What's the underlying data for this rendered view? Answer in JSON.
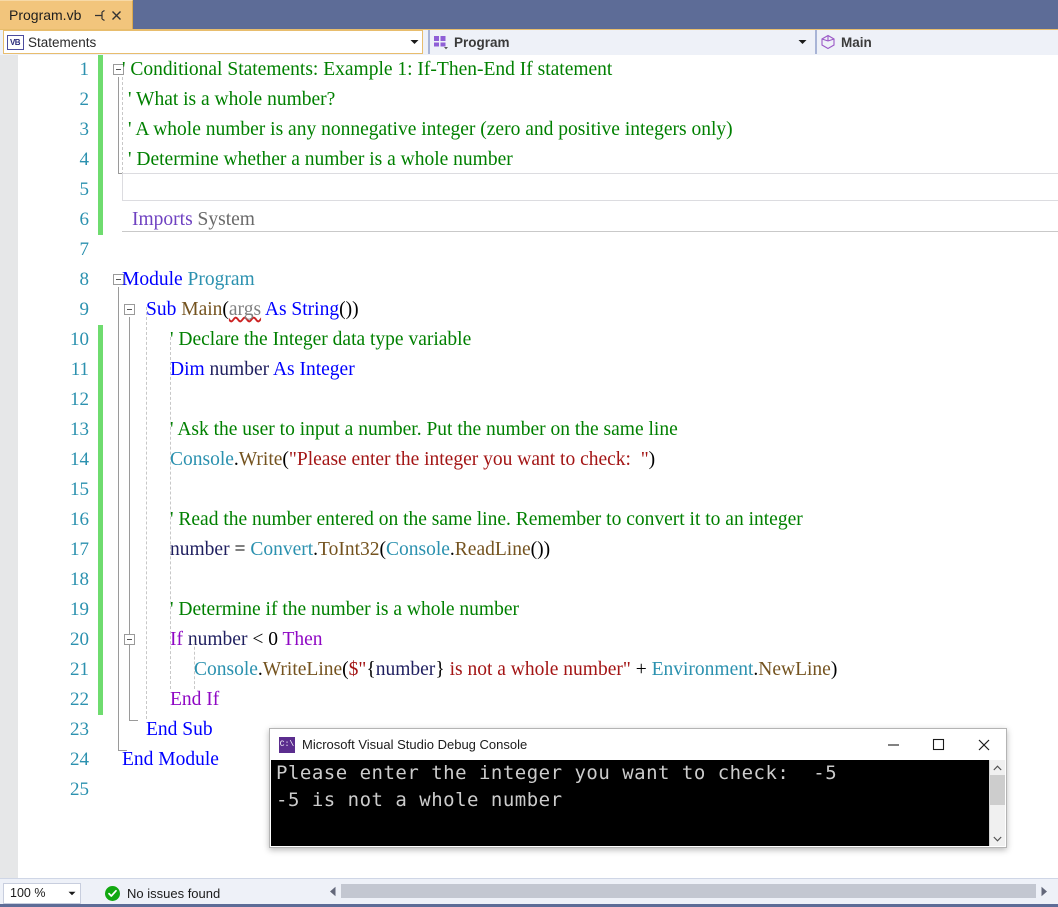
{
  "tab": {
    "title": "Program.vb",
    "pin_icon": "pin-icon",
    "close_icon": "close-icon"
  },
  "navbar": {
    "project": {
      "icon": "vb-file-icon",
      "badge": "VB",
      "value": "Statements",
      "caret": "chevron-down-icon"
    },
    "type": {
      "icon": "module-icon",
      "value": "Program",
      "caret": "chevron-down-icon"
    },
    "member": {
      "icon": "method-cube-icon",
      "value": "Main"
    }
  },
  "editor": {
    "line_numbers": [
      "1",
      "2",
      "3",
      "4",
      "5",
      "6",
      "7",
      "8",
      "9",
      "10",
      "11",
      "12",
      "13",
      "14",
      "15",
      "16",
      "17",
      "18",
      "19",
      "20",
      "21",
      "22",
      "23",
      "24",
      "25"
    ],
    "lines": [
      {
        "n": 1,
        "indent": 0,
        "text": "' Conditional Statements: Example 1: If-Then-End If statement"
      },
      {
        "n": 2,
        "indent": 0,
        "text": "' What is a whole number?"
      },
      {
        "n": 3,
        "indent": 0,
        "text": "' A whole number is any nonnegative integer (zero and positive integers only)"
      },
      {
        "n": 4,
        "indent": 0,
        "text": "' Determine whether a number is a whole number"
      },
      {
        "n": 5,
        "indent": 0,
        "text": ""
      },
      {
        "n": 6,
        "indent": 0,
        "text": "Imports System"
      },
      {
        "n": 7,
        "indent": 0,
        "text": ""
      },
      {
        "n": 8,
        "indent": 0,
        "text": "Module Program"
      },
      {
        "n": 9,
        "indent": 1,
        "text": "Sub Main(args As String())"
      },
      {
        "n": 10,
        "indent": 2,
        "text": "' Declare the Integer data type variable"
      },
      {
        "n": 11,
        "indent": 2,
        "text": "Dim number As Integer"
      },
      {
        "n": 12,
        "indent": 2,
        "text": ""
      },
      {
        "n": 13,
        "indent": 2,
        "text": "' Ask the user to input a number. Put the number on the same line"
      },
      {
        "n": 14,
        "indent": 2,
        "text": "Console.Write(\"Please enter the integer you want to check:  \")"
      },
      {
        "n": 15,
        "indent": 2,
        "text": ""
      },
      {
        "n": 16,
        "indent": 2,
        "text": "' Read the number entered on the same line. Remember to convert it to an integer"
      },
      {
        "n": 17,
        "indent": 2,
        "text": "number = Convert.ToInt32(Console.ReadLine())"
      },
      {
        "n": 18,
        "indent": 2,
        "text": ""
      },
      {
        "n": 19,
        "indent": 2,
        "text": "' Determine if the number is a whole number"
      },
      {
        "n": 20,
        "indent": 2,
        "text": "If number < 0 Then"
      },
      {
        "n": 21,
        "indent": 3,
        "text": "Console.WriteLine($\"{number} is not a whole number\" + Environment.NewLine)"
      },
      {
        "n": 22,
        "indent": 2,
        "text": "End If"
      },
      {
        "n": 23,
        "indent": 1,
        "text": "End Sub"
      },
      {
        "n": 24,
        "indent": 0,
        "text": "End Module"
      },
      {
        "n": 25,
        "indent": 0,
        "text": ""
      }
    ],
    "colors": {
      "comment": "#008000",
      "keyword": "#0000ff",
      "control_keyword": "#8f08c4",
      "string": "#a31515",
      "type": "#2b91af",
      "method": "#74531f",
      "parameter": "#808080",
      "change_bar": "#6fdc6f",
      "line_number": "#2b91af"
    }
  },
  "console": {
    "title": "Microsoft Visual Studio Debug Console",
    "icon": "cmd-console-icon",
    "minimize_label": "─",
    "maximize_label": "☐",
    "close_label": "✕",
    "output": [
      "Please enter the integer you want to check:  -5",
      "-5 is not a whole number"
    ],
    "scroll_up_icon": "chevron-up-icon",
    "scroll_down_icon": "chevron-down-icon"
  },
  "statusbar": {
    "zoom": "100 %",
    "zoom_caret": "chevron-down-icon",
    "issues_icon": "check-circle-icon",
    "issues": "No issues found",
    "scroll_left_icon": "triangle-left-icon",
    "scroll_right_icon": "triangle-right-icon"
  }
}
